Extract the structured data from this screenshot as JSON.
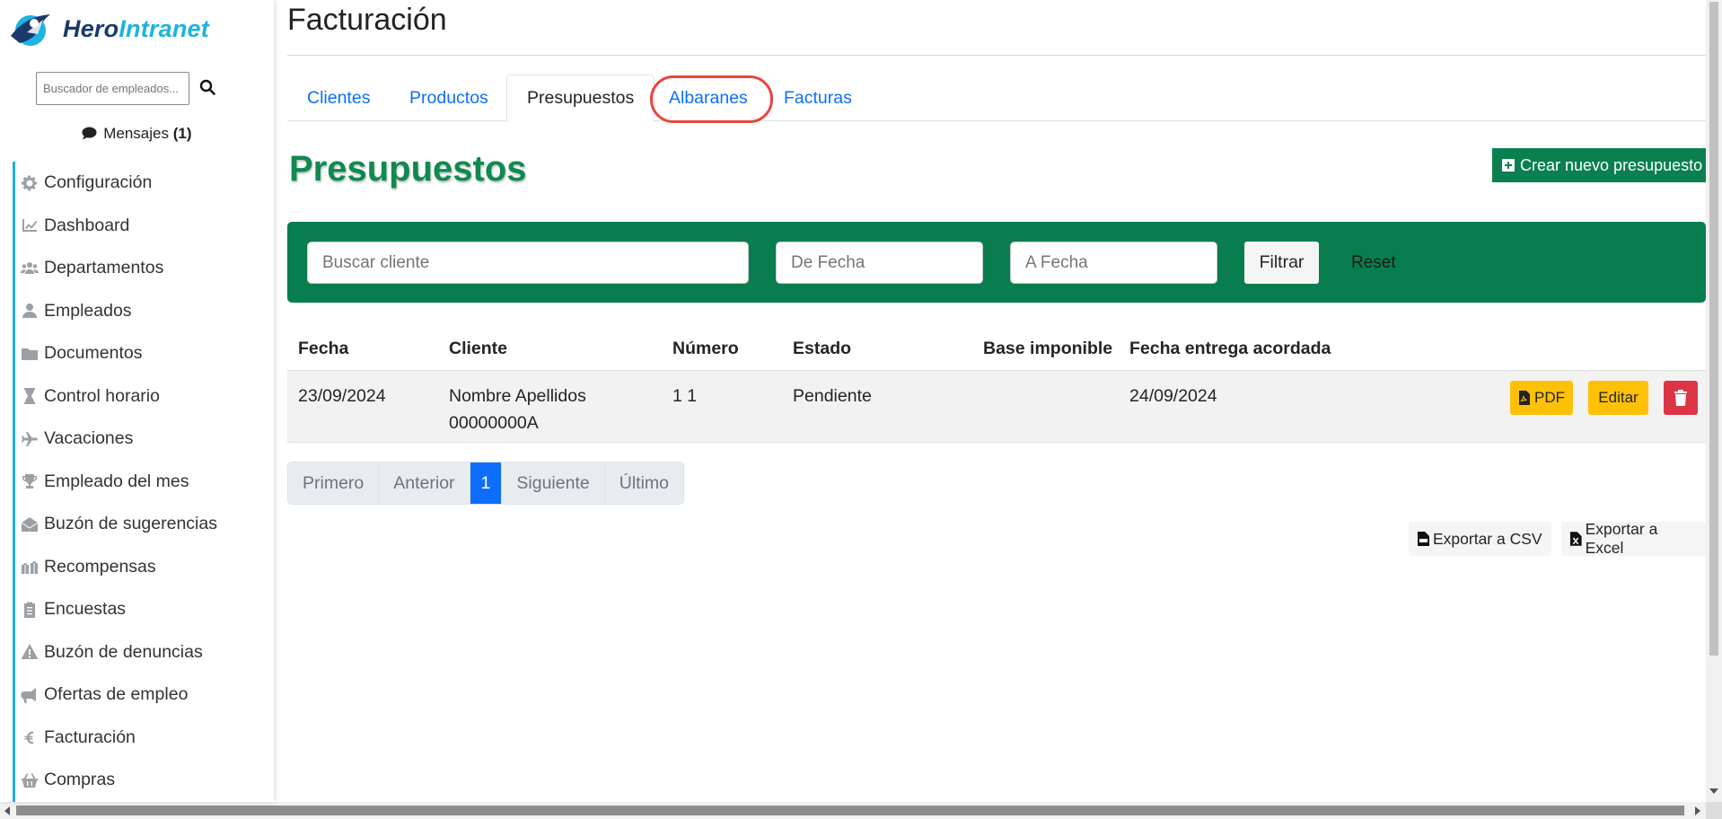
{
  "app": {
    "logo_part1": "Hero",
    "logo_part2": "Intranet"
  },
  "sidebar": {
    "search_placeholder": "Buscador de empleados...",
    "messages_label": "Mensajes",
    "messages_count": "(1)",
    "items": [
      {
        "label": "Configuración",
        "icon": "gear-icon"
      },
      {
        "label": "Dashboard",
        "icon": "chart-line-icon"
      },
      {
        "label": "Departamentos",
        "icon": "users-icon"
      },
      {
        "label": "Empleados",
        "icon": "user-icon"
      },
      {
        "label": "Documentos",
        "icon": "folder-icon"
      },
      {
        "label": "Control horario",
        "icon": "hourglass-icon"
      },
      {
        "label": "Vacaciones",
        "icon": "plane-icon"
      },
      {
        "label": "Empleado del mes",
        "icon": "trophy-icon"
      },
      {
        "label": "Buzón de sugerencias",
        "icon": "envelope-open-icon"
      },
      {
        "label": "Recompensas",
        "icon": "gifts-icon"
      },
      {
        "label": "Encuestas",
        "icon": "clipboard-list-icon"
      },
      {
        "label": "Buzón de denuncias",
        "icon": "warning-icon"
      },
      {
        "label": "Ofertas de empleo",
        "icon": "bullhorn-icon"
      },
      {
        "label": "Facturación",
        "icon": "euro-icon"
      },
      {
        "label": "Compras",
        "icon": "basket-icon"
      }
    ]
  },
  "main": {
    "title": "Facturación",
    "tabs": [
      {
        "label": "Clientes"
      },
      {
        "label": "Productos"
      },
      {
        "label": "Presupuestos",
        "active": true
      },
      {
        "label": "Albaranes",
        "highlighted": true
      },
      {
        "label": "Facturas"
      }
    ],
    "section_title": "Presupuestos",
    "create_button": "Crear nuevo presupuesto",
    "filters": {
      "client_placeholder": "Buscar cliente",
      "from_placeholder": "De Fecha",
      "to_placeholder": "A Fecha",
      "filter_button": "Filtrar",
      "reset_button": "Reset"
    },
    "table": {
      "headers": [
        "Fecha",
        "Cliente",
        "Número",
        "Estado",
        "Base imponible",
        "Fecha entrega acordada"
      ],
      "rows": [
        {
          "fecha": "23/09/2024",
          "cliente_line1": "Nombre Apellidos",
          "cliente_line2": "00000000A",
          "numero": "1 1",
          "estado": "Pendiente",
          "base": "",
          "entrega": "24/09/2024",
          "pdf_label": "PDF",
          "edit_label": "Editar"
        }
      ]
    },
    "pagination": [
      "Primero",
      "Anterior",
      "1",
      "Siguiente",
      "Último"
    ],
    "export_csv": "Exportar a CSV",
    "export_excel": "Exportar a Excel"
  },
  "colors": {
    "brand_green": "#087d4d",
    "title_green": "#0f8a4f",
    "accent_cyan": "#1cb3e0",
    "link_blue": "#0d6efd",
    "warning_yellow": "#ffc107",
    "danger_red": "#dc3545",
    "highlight_ring": "#e8453c"
  }
}
